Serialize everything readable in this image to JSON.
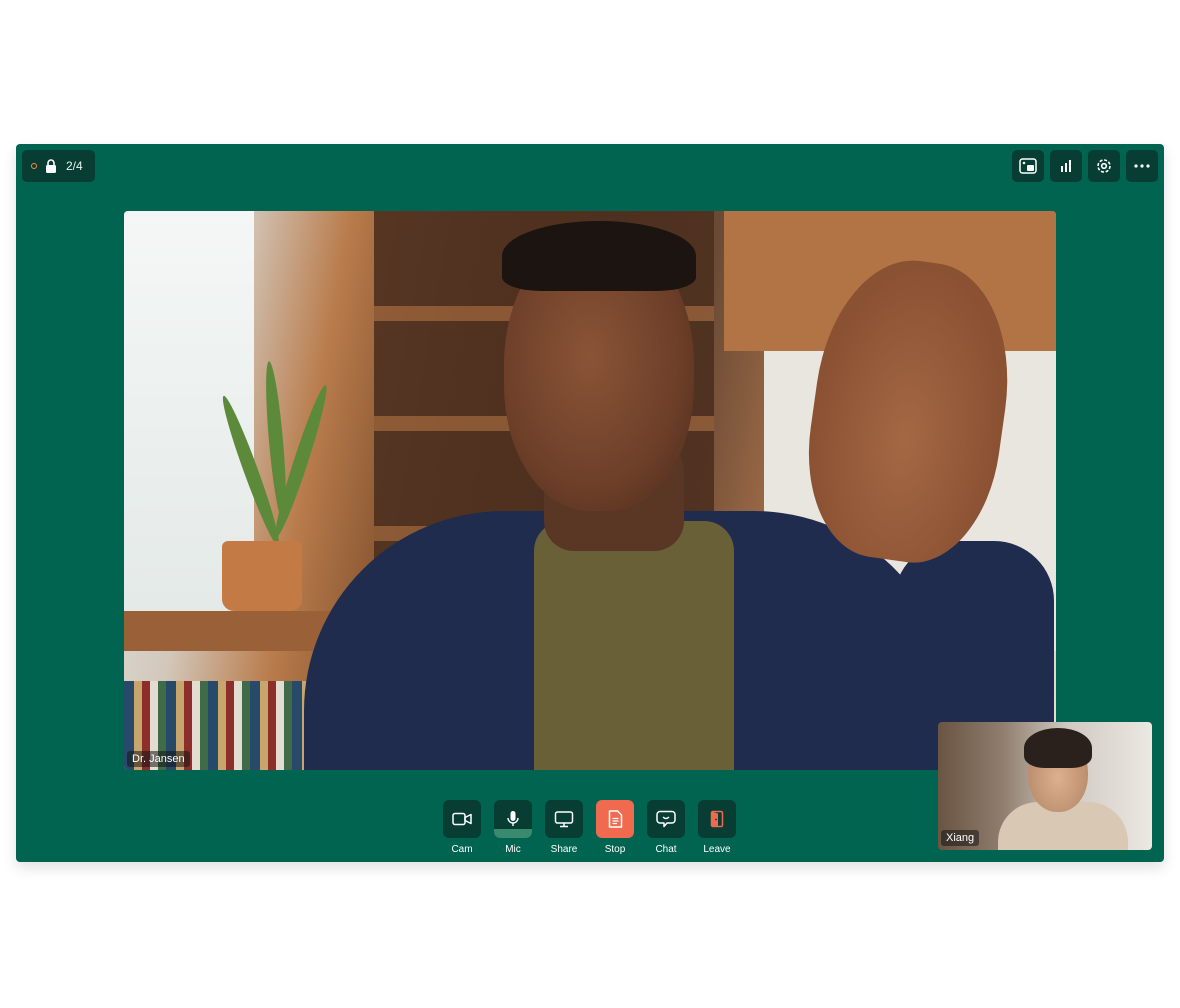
{
  "header": {
    "participant_count": "2/4"
  },
  "main_video": {
    "participant_name": "Dr. Jansen"
  },
  "self_view": {
    "participant_name": "Xiang"
  },
  "toolbar": {
    "cam_label": "Cam",
    "mic_label": "Mic",
    "share_label": "Share",
    "stop_label": "Stop",
    "chat_label": "Chat",
    "leave_label": "Leave"
  },
  "top_actions": {
    "icons": [
      "layout-icon",
      "stats-icon",
      "settings-icon",
      "more-icon"
    ]
  },
  "colors": {
    "background": "#006450",
    "button": "#073d33",
    "stop_accent": "#ef6a4f",
    "recording": "#ff8a3d",
    "mic_level": "#3a8a70"
  }
}
